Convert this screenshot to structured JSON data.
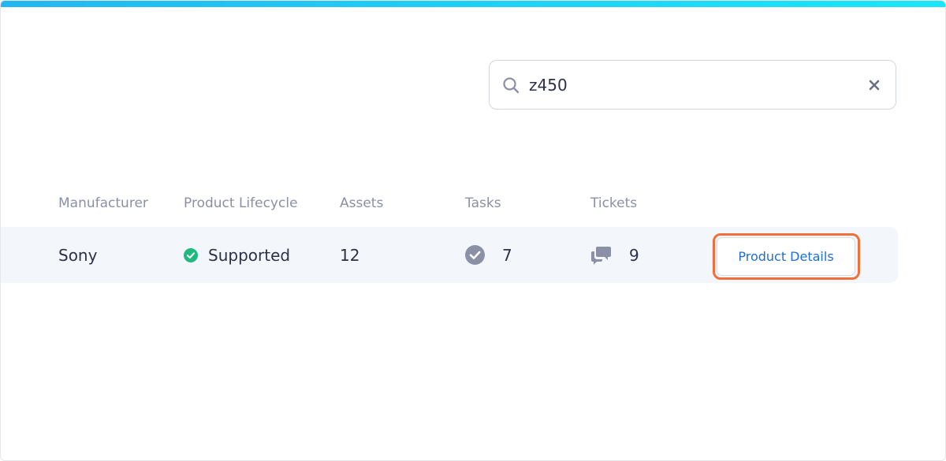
{
  "search": {
    "value": "z450",
    "placeholder": ""
  },
  "table": {
    "columns": [
      "Manufacturer",
      "Product Lifecycle",
      "Assets",
      "Tasks",
      "Tickets"
    ],
    "rows": [
      {
        "manufacturer": "Sony",
        "lifecycle": "Supported",
        "assets": "12",
        "tasks": "7",
        "tickets": "9",
        "action_label": "Product Details"
      }
    ]
  },
  "icons": {
    "search": "search-icon",
    "clear": "close-icon",
    "status": "check-circle-icon",
    "tasks": "check-circle-icon",
    "tickets": "chat-bubbles-icon"
  },
  "colors": {
    "accent_bar": "#1ed2f5",
    "status_green": "#1fba7f",
    "link_blue": "#1e6fd9",
    "highlight_orange": "#f0703a",
    "icon_gray": "#8b90a7"
  }
}
